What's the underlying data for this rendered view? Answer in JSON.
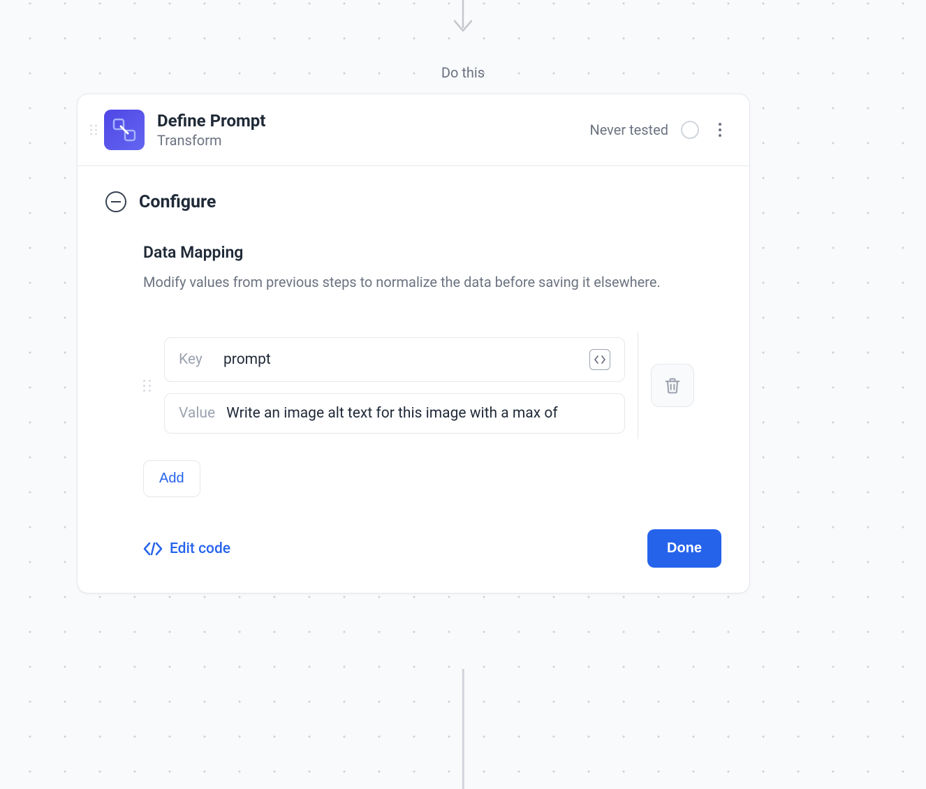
{
  "flow": {
    "above_label": "Do this"
  },
  "card": {
    "title": "Define Prompt",
    "subtitle": "Transform",
    "status_text": "Never tested"
  },
  "section": {
    "title": "Configure"
  },
  "group": {
    "title": "Data Mapping",
    "description": "Modify values from previous steps to normalize the data before saving it elsewhere."
  },
  "mapping": {
    "key_label": "Key",
    "key_value": "prompt",
    "value_label": "Value",
    "value_value": "Write an image alt text for this image with a max of"
  },
  "actions": {
    "add": "Add",
    "edit_code": "Edit code",
    "done": "Done"
  },
  "colors": {
    "primary": "#2563eb",
    "text": "#1f2937",
    "muted": "#6b7280",
    "border": "#e5e7eb"
  }
}
